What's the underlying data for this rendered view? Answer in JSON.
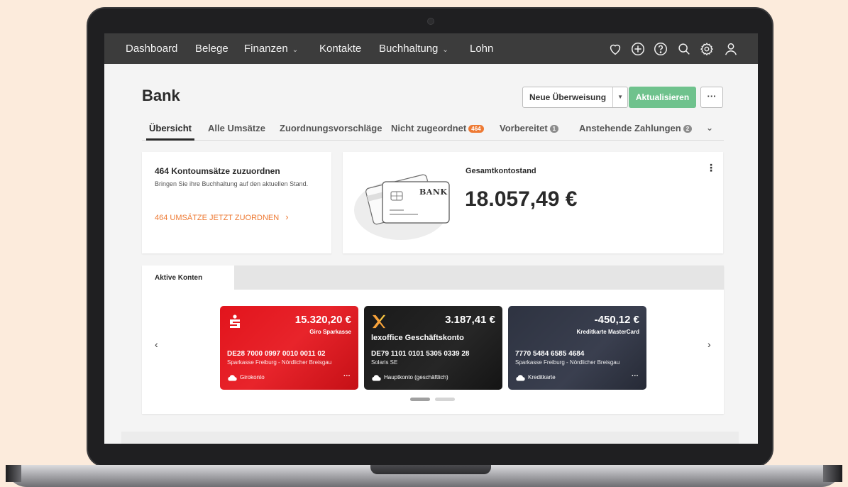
{
  "nav": {
    "items": [
      {
        "label": "Dashboard"
      },
      {
        "label": "Belege"
      },
      {
        "label": "Finanzen",
        "dropdown": true
      },
      {
        "label": "Kontakte"
      },
      {
        "label": "Buchhaltung",
        "dropdown": true
      },
      {
        "label": "Lohn"
      }
    ],
    "chevron": "⌄",
    "icons": [
      "heart-icon",
      "plus-circle-icon",
      "help-icon",
      "search-icon",
      "settings-icon",
      "user-icon"
    ]
  },
  "page": {
    "title": "Bank",
    "buttons": {
      "new_transfer": "Neue Überweisung",
      "refresh": "Aktualisieren",
      "more": "···"
    }
  },
  "tabs": [
    {
      "label": "Übersicht",
      "active": true
    },
    {
      "label": "Alle Umsätze"
    },
    {
      "label": "Zuordnungsvorschläge"
    },
    {
      "label": "Nicht zugeordnet",
      "badge": "464"
    },
    {
      "label": "Vorbereitet",
      "badge": "1"
    },
    {
      "label": "Anstehende Zahlungen",
      "badge": "2"
    }
  ],
  "tabs_more": "⌄",
  "assign_card": {
    "title": "464 Kontoumsätze zuzuordnen",
    "description": "Bringen Sie ihre Buchhaltung auf den aktuellen Stand.",
    "link": "464 UMSÄTZE JETZT ZUORDNEN",
    "link_arrow": "›"
  },
  "balance_card": {
    "illustration_text": "BANK",
    "label": "Gesamtkontostand",
    "amount": "18.057,49 €",
    "menu": "⋮"
  },
  "accounts": {
    "tab_label": "Aktive Konten",
    "prev": "‹",
    "next": "›",
    "cards": [
      {
        "amount": "15.320,20 €",
        "subtitle": "Giro Sparkasse",
        "name": "",
        "iban": "DE28 7000 0997 0010 0011 02",
        "institute": "Sparkasse Freiburg - Nördlicher Breisgau",
        "type": "Girokonto",
        "color": "#e2141c"
      },
      {
        "amount": "3.187,41 €",
        "subtitle": "",
        "name": "lexoffice Geschäftskonto",
        "iban": "DE79 1101 0101 5305 0339 28",
        "institute": "Solaris SE",
        "type": "Hauptkonto (geschäftlich)",
        "color": "#1a1a1a"
      },
      {
        "amount": "-450,12 €",
        "subtitle": "Kreditkarte MasterCard",
        "name": "",
        "iban": "7770 5484 6585 4684",
        "institute": "Sparkasse Freiburg - Nördlicher Breisgau",
        "type": "Kreditkarte",
        "color": "#2e3341"
      }
    ],
    "card_menu": "···",
    "pagination": {
      "pages": 2,
      "current": 1
    }
  },
  "colors": {
    "nav_bg": "#3c3c3c",
    "primary_button": "#6fc28d",
    "accent_orange": "#ee7a34",
    "page_bg": "#fcebdc"
  }
}
